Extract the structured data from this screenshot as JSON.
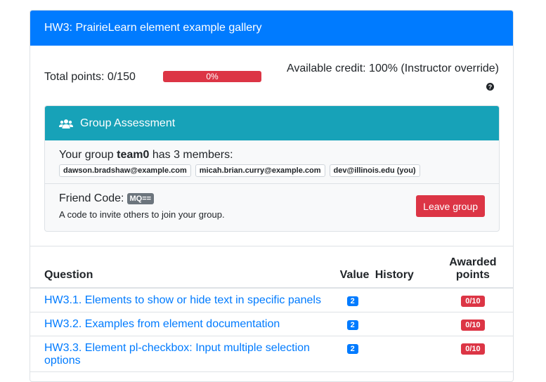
{
  "header": {
    "title": "HW3: PrairieLearn element example gallery"
  },
  "summary": {
    "total_points": "Total points: 0/150",
    "progress_label": "0%",
    "progress_value": 0,
    "available_credit": "Available credit: 100% (Instructor override)",
    "help_icon": "?"
  },
  "group": {
    "title": "Group Assessment",
    "members_prefix": "Your group ",
    "group_name": "team0",
    "members_suffix": " has 3 members:",
    "members": [
      "dawson.bradshaw@example.com",
      "micah.brian.curry@example.com",
      "dev@illinois.edu (you)"
    ],
    "friend_code_label": "Friend Code:",
    "friend_code": "MQ==",
    "friend_code_desc": "A code to invite others to join your group.",
    "leave_button": "Leave group"
  },
  "table": {
    "headers": {
      "question": "Question",
      "value": "Value",
      "history": "History",
      "awarded_1": "Awarded",
      "awarded_2": "points"
    },
    "rows": [
      {
        "question": "HW3.1. Elements to show or hide text in specific panels",
        "value": "2",
        "awarded": "0/10"
      },
      {
        "question": "HW3.2. Examples from element documentation",
        "value": "2",
        "awarded": "0/10"
      },
      {
        "question": "HW3.3. Element pl-checkbox: Input multiple selection options",
        "value": "2",
        "awarded": "0/10"
      }
    ]
  },
  "colors": {
    "primary": "#007bff",
    "info": "#17a2b8",
    "danger": "#dc3545",
    "secondary": "#6c757d"
  }
}
